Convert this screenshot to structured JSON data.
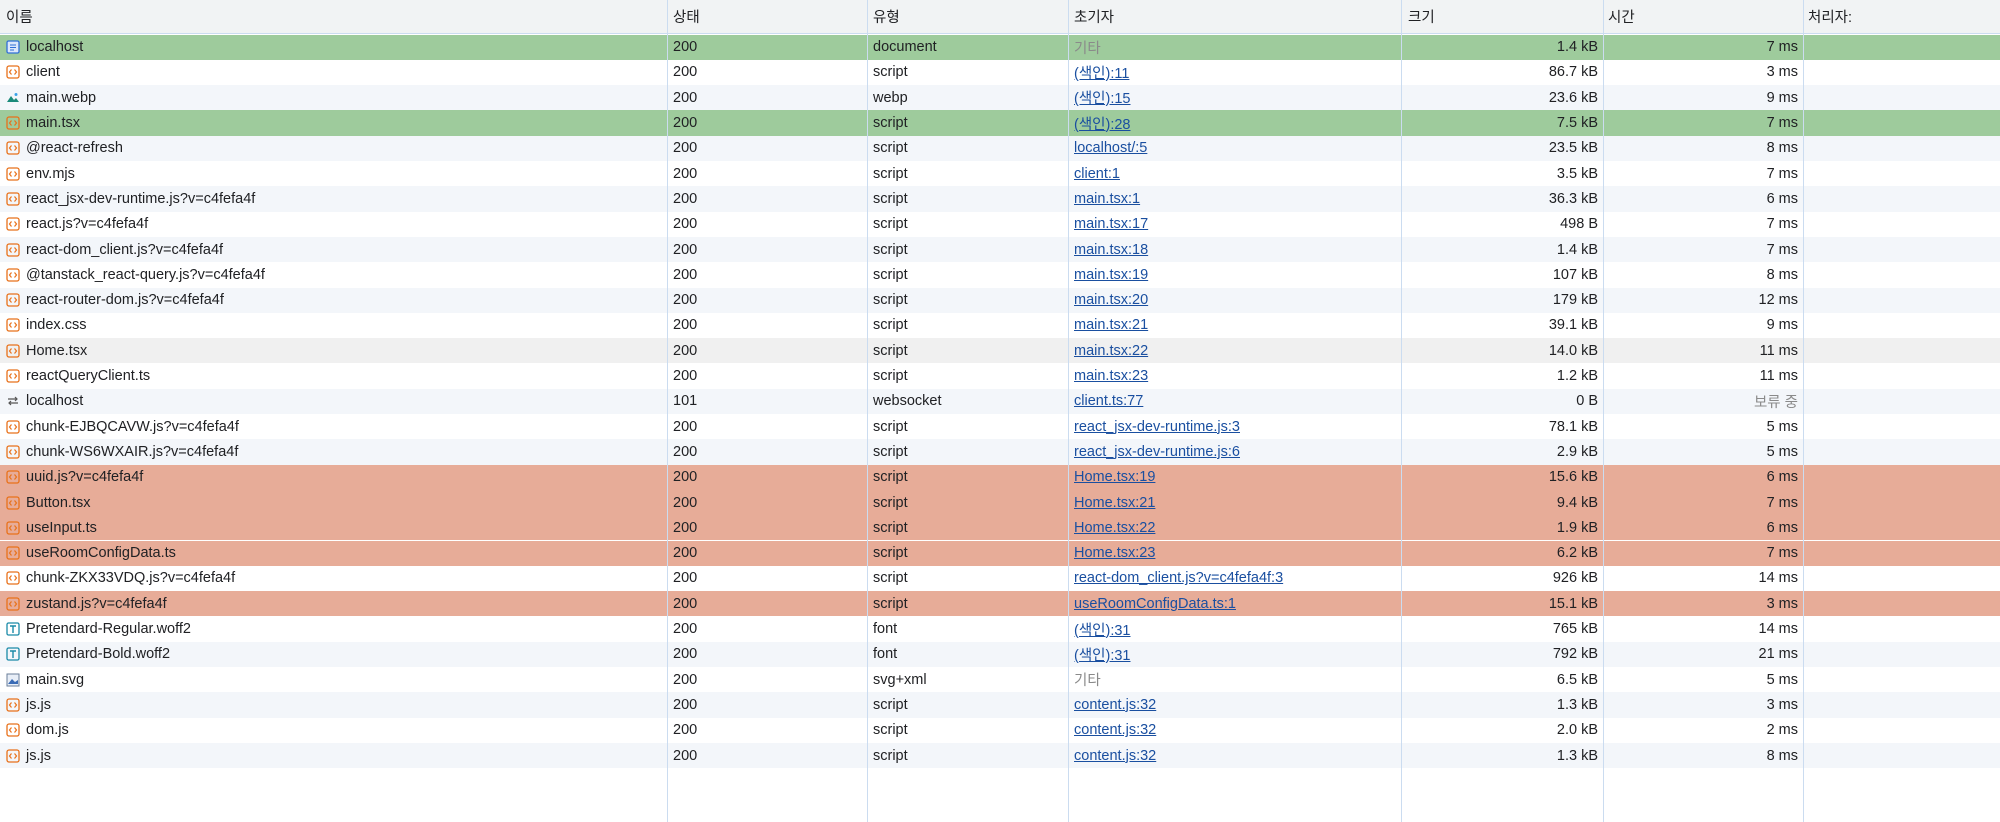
{
  "columns": {
    "name": "이름",
    "status": "상태",
    "type": "유형",
    "initiator": "초기자",
    "size": "크기",
    "time": "시간",
    "handler": "처리자:"
  },
  "rows": [
    {
      "name": "localhost",
      "icon": "document-icon",
      "status": "200",
      "type": "document",
      "initiator": "기타",
      "initiator_link": false,
      "size": "1.4 kB",
      "time": "7 ms",
      "highlight": "green"
    },
    {
      "name": "client",
      "icon": "script-icon",
      "status": "200",
      "type": "script",
      "initiator": "(색인):11",
      "initiator_link": true,
      "size": "86.7 kB",
      "time": "3 ms",
      "highlight": "none"
    },
    {
      "name": "main.webp",
      "icon": "image-icon",
      "status": "200",
      "type": "webp",
      "initiator": "(색인):15",
      "initiator_link": true,
      "size": "23.6 kB",
      "time": "9 ms",
      "highlight": "none"
    },
    {
      "name": "main.tsx",
      "icon": "script-icon",
      "status": "200",
      "type": "script",
      "initiator": "(색인):28",
      "initiator_link": true,
      "size": "7.5 kB",
      "time": "7 ms",
      "highlight": "green"
    },
    {
      "name": "@react-refresh",
      "icon": "script-icon",
      "status": "200",
      "type": "script",
      "initiator": "localhost/:5",
      "initiator_link": true,
      "size": "23.5 kB",
      "time": "8 ms",
      "highlight": "none"
    },
    {
      "name": "env.mjs",
      "icon": "script-icon",
      "status": "200",
      "type": "script",
      "initiator": "client:1",
      "initiator_link": true,
      "size": "3.5 kB",
      "time": "7 ms",
      "highlight": "none"
    },
    {
      "name": "react_jsx-dev-runtime.js?v=c4fefa4f",
      "icon": "script-icon",
      "status": "200",
      "type": "script",
      "initiator": "main.tsx:1",
      "initiator_link": true,
      "size": "36.3 kB",
      "time": "6 ms",
      "highlight": "none"
    },
    {
      "name": "react.js?v=c4fefa4f",
      "icon": "script-icon",
      "status": "200",
      "type": "script",
      "initiator": "main.tsx:17",
      "initiator_link": true,
      "size": "498 B",
      "time": "7 ms",
      "highlight": "none"
    },
    {
      "name": "react-dom_client.js?v=c4fefa4f",
      "icon": "script-icon",
      "status": "200",
      "type": "script",
      "initiator": "main.tsx:18",
      "initiator_link": true,
      "size": "1.4 kB",
      "time": "7 ms",
      "highlight": "none"
    },
    {
      "name": "@tanstack_react-query.js?v=c4fefa4f",
      "icon": "script-icon",
      "status": "200",
      "type": "script",
      "initiator": "main.tsx:19",
      "initiator_link": true,
      "size": "107 kB",
      "time": "8 ms",
      "highlight": "none"
    },
    {
      "name": "react-router-dom.js?v=c4fefa4f",
      "icon": "script-icon",
      "status": "200",
      "type": "script",
      "initiator": "main.tsx:20",
      "initiator_link": true,
      "size": "179 kB",
      "time": "12 ms",
      "highlight": "none"
    },
    {
      "name": "index.css",
      "icon": "script-icon",
      "status": "200",
      "type": "script",
      "initiator": "main.tsx:21",
      "initiator_link": true,
      "size": "39.1 kB",
      "time": "9 ms",
      "highlight": "none"
    },
    {
      "name": "Home.tsx",
      "icon": "script-icon",
      "status": "200",
      "type": "script",
      "initiator": "main.tsx:22",
      "initiator_link": true,
      "size": "14.0 kB",
      "time": "11 ms",
      "highlight": "gray"
    },
    {
      "name": "reactQueryClient.ts",
      "icon": "script-icon",
      "status": "200",
      "type": "script",
      "initiator": "main.tsx:23",
      "initiator_link": true,
      "size": "1.2 kB",
      "time": "11 ms",
      "highlight": "none"
    },
    {
      "name": "localhost",
      "icon": "websocket-icon",
      "status": "101",
      "type": "websocket",
      "initiator": "client.ts:77",
      "initiator_link": true,
      "size": "0 B",
      "time": "보류 중",
      "time_muted": true,
      "highlight": "none"
    },
    {
      "name": "chunk-EJBQCAVW.js?v=c4fefa4f",
      "icon": "script-icon",
      "status": "200",
      "type": "script",
      "initiator": "react_jsx-dev-runtime.js:3",
      "initiator_link": true,
      "size": "78.1 kB",
      "time": "5 ms",
      "highlight": "none"
    },
    {
      "name": "chunk-WS6WXAIR.js?v=c4fefa4f",
      "icon": "script-icon",
      "status": "200",
      "type": "script",
      "initiator": "react_jsx-dev-runtime.js:6",
      "initiator_link": true,
      "size": "2.9 kB",
      "time": "5 ms",
      "highlight": "none"
    },
    {
      "name": "uuid.js?v=c4fefa4f",
      "icon": "script-icon",
      "status": "200",
      "type": "script",
      "initiator": "Home.tsx:19",
      "initiator_link": true,
      "size": "15.6 kB",
      "time": "6 ms",
      "highlight": "red"
    },
    {
      "name": "Button.tsx",
      "icon": "script-icon",
      "status": "200",
      "type": "script",
      "initiator": "Home.tsx:21",
      "initiator_link": true,
      "size": "9.4 kB",
      "time": "7 ms",
      "highlight": "red"
    },
    {
      "name": "useInput.ts",
      "icon": "script-icon",
      "status": "200",
      "type": "script",
      "initiator": "Home.tsx:22",
      "initiator_link": true,
      "size": "1.9 kB",
      "time": "6 ms",
      "highlight": "red"
    },
    {
      "name": "useRoomConfigData.ts",
      "icon": "script-icon",
      "status": "200",
      "type": "script",
      "initiator": "Home.tsx:23",
      "initiator_link": true,
      "size": "6.2 kB",
      "time": "7 ms",
      "highlight": "red"
    },
    {
      "name": "chunk-ZKX33VDQ.js?v=c4fefa4f",
      "icon": "script-icon",
      "status": "200",
      "type": "script",
      "initiator": "react-dom_client.js?v=c4fefa4f:3",
      "initiator_link": true,
      "size": "926 kB",
      "time": "14 ms",
      "highlight": "none"
    },
    {
      "name": "zustand.js?v=c4fefa4f",
      "icon": "script-icon",
      "status": "200",
      "type": "script",
      "initiator": "useRoomConfigData.ts:1",
      "initiator_link": true,
      "size": "15.1 kB",
      "time": "3 ms",
      "highlight": "red"
    },
    {
      "name": "Pretendard-Regular.woff2",
      "icon": "font-icon",
      "status": "200",
      "type": "font",
      "initiator": "(색인):31",
      "initiator_link": true,
      "size": "765 kB",
      "time": "14 ms",
      "highlight": "none"
    },
    {
      "name": "Pretendard-Bold.woff2",
      "icon": "font-icon",
      "status": "200",
      "type": "font",
      "initiator": "(색인):31",
      "initiator_link": true,
      "size": "792 kB",
      "time": "21 ms",
      "highlight": "none"
    },
    {
      "name": "main.svg",
      "icon": "svg-image-icon",
      "status": "200",
      "type": "svg+xml",
      "initiator": "기타",
      "initiator_link": false,
      "size": "6.5 kB",
      "time": "5 ms",
      "highlight": "none"
    },
    {
      "name": "js.js",
      "icon": "script-icon",
      "status": "200",
      "type": "script",
      "initiator": "content.js:32",
      "initiator_link": true,
      "size": "1.3 kB",
      "time": "3 ms",
      "highlight": "none"
    },
    {
      "name": "dom.js",
      "icon": "script-icon",
      "status": "200",
      "type": "script",
      "initiator": "content.js:32",
      "initiator_link": true,
      "size": "2.0 kB",
      "time": "2 ms",
      "highlight": "none"
    },
    {
      "name": "js.js",
      "icon": "script-icon",
      "status": "200",
      "type": "script",
      "initiator": "content.js:32",
      "initiator_link": true,
      "size": "1.3 kB",
      "time": "8 ms",
      "highlight": "none"
    }
  ],
  "colors": {
    "highlight_green": "#9ecb9c",
    "highlight_red": "#e7ac98",
    "highlight_gray": "#f0f0f0",
    "link": "#1a4fa0",
    "grid_line": "#cbdcf0"
  }
}
